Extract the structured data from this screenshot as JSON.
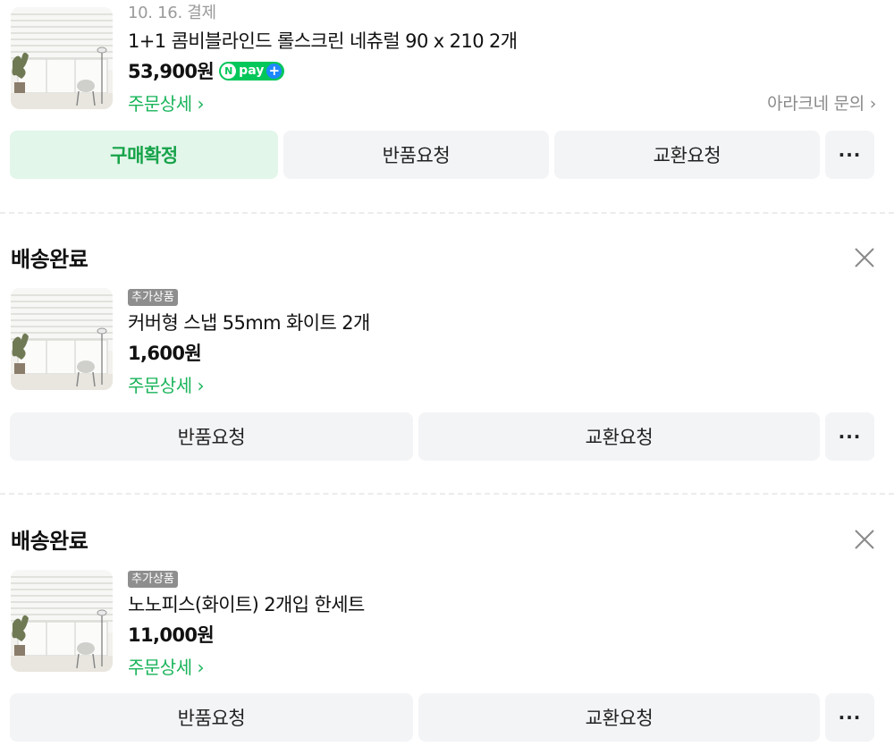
{
  "orders": [
    {
      "date": "10. 16. 결제",
      "product_name": "1+1 콤비블라인드 롤스크린 네츄럴 90 x 210 2개",
      "price": "53,900원",
      "npay_label": "pay",
      "npay_n": "N",
      "npay_plus": "+",
      "detail_link": "주문상세 ›",
      "seller_link": "아라크네 문의 ›",
      "buttons": {
        "confirm": "구매확정",
        "return": "반품요청",
        "exchange": "교환요청",
        "more": "···"
      }
    },
    {
      "status": "배송완료",
      "badge": "추가상품",
      "product_name": "커버형 스냅 55mm 화이트 2개",
      "price": "1,600원",
      "detail_link": "주문상세 ›",
      "buttons": {
        "return": "반품요청",
        "exchange": "교환요청",
        "more": "···"
      }
    },
    {
      "status": "배송완료",
      "badge": "추가상품",
      "product_name": "노노피스(화이트) 2개입 한세트",
      "price": "11,000원",
      "detail_link": "주문상세 ›",
      "buttons": {
        "return": "반품요청",
        "exchange": "교환요청",
        "more": "···"
      }
    }
  ],
  "icons": {
    "close": "close-icon",
    "thumbnail": "blind-product-image"
  }
}
